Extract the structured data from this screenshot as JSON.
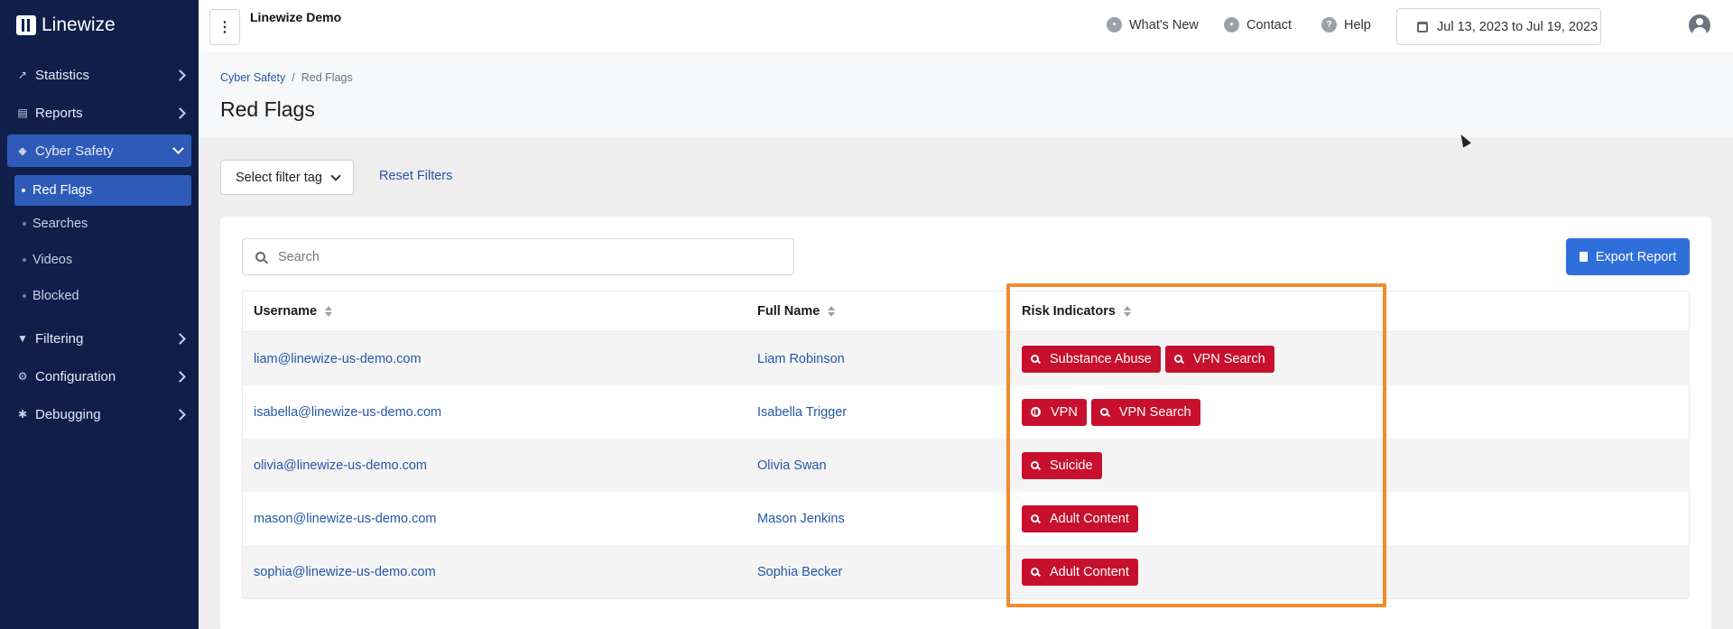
{
  "brand": {
    "name": "Linewize"
  },
  "sidebar": {
    "items": [
      {
        "label": "Statistics",
        "icon": "chart-icon"
      },
      {
        "label": "Reports",
        "icon": "document-icon"
      },
      {
        "label": "Cyber Safety",
        "icon": "shield-icon"
      },
      {
        "label": "Filtering",
        "icon": "filter-icon"
      },
      {
        "label": "Configuration",
        "icon": "gear-icon"
      },
      {
        "label": "Debugging",
        "icon": "bug-icon"
      }
    ],
    "sub_items": [
      {
        "label": "Red Flags"
      },
      {
        "label": "Searches"
      },
      {
        "label": "Videos"
      },
      {
        "label": "Blocked"
      }
    ]
  },
  "topbar": {
    "org_name": "Linewize Demo",
    "whats_new": "What's New",
    "contact": "Contact",
    "help": "Help",
    "date_range": "Jul 13, 2023 to Jul 19, 2023"
  },
  "breadcrumb": {
    "parent": "Cyber Safety",
    "separator": "/",
    "current": "Red Flags"
  },
  "page": {
    "title": "Red Flags"
  },
  "filters": {
    "select_tag": "Select filter tag",
    "reset": "Reset Filters"
  },
  "search": {
    "placeholder": "Search"
  },
  "export": {
    "label": "Export Report"
  },
  "table": {
    "headers": [
      "Username",
      "Full Name",
      "Risk Indicators"
    ],
    "rows": [
      {
        "username": "liam@linewize-us-demo.com",
        "full_name": "Liam Robinson",
        "risks": [
          {
            "label": "Substance Abuse",
            "icon": "search-icon"
          },
          {
            "label": "VPN Search",
            "icon": "search-icon"
          }
        ]
      },
      {
        "username": "isabella@linewize-us-demo.com",
        "full_name": "Isabella Trigger",
        "risks": [
          {
            "label": "VPN",
            "icon": "globe-icon"
          },
          {
            "label": "VPN Search",
            "icon": "search-icon"
          }
        ]
      },
      {
        "username": "olivia@linewize-us-demo.com",
        "full_name": "Olivia Swan",
        "risks": [
          {
            "label": "Suicide",
            "icon": "search-icon"
          }
        ]
      },
      {
        "username": "mason@linewize-us-demo.com",
        "full_name": "Mason Jenkins",
        "risks": [
          {
            "label": "Adult Content",
            "icon": "search-icon"
          }
        ]
      },
      {
        "username": "sophia@linewize-us-demo.com",
        "full_name": "Sophia Becker",
        "risks": [
          {
            "label": "Adult Content",
            "icon": "search-icon"
          }
        ]
      }
    ]
  },
  "colors": {
    "sidebar_bg": "#0f1f4a",
    "accent": "#2e5bb8",
    "risk_tag": "#c8102e",
    "highlight": "#f28a2e"
  }
}
